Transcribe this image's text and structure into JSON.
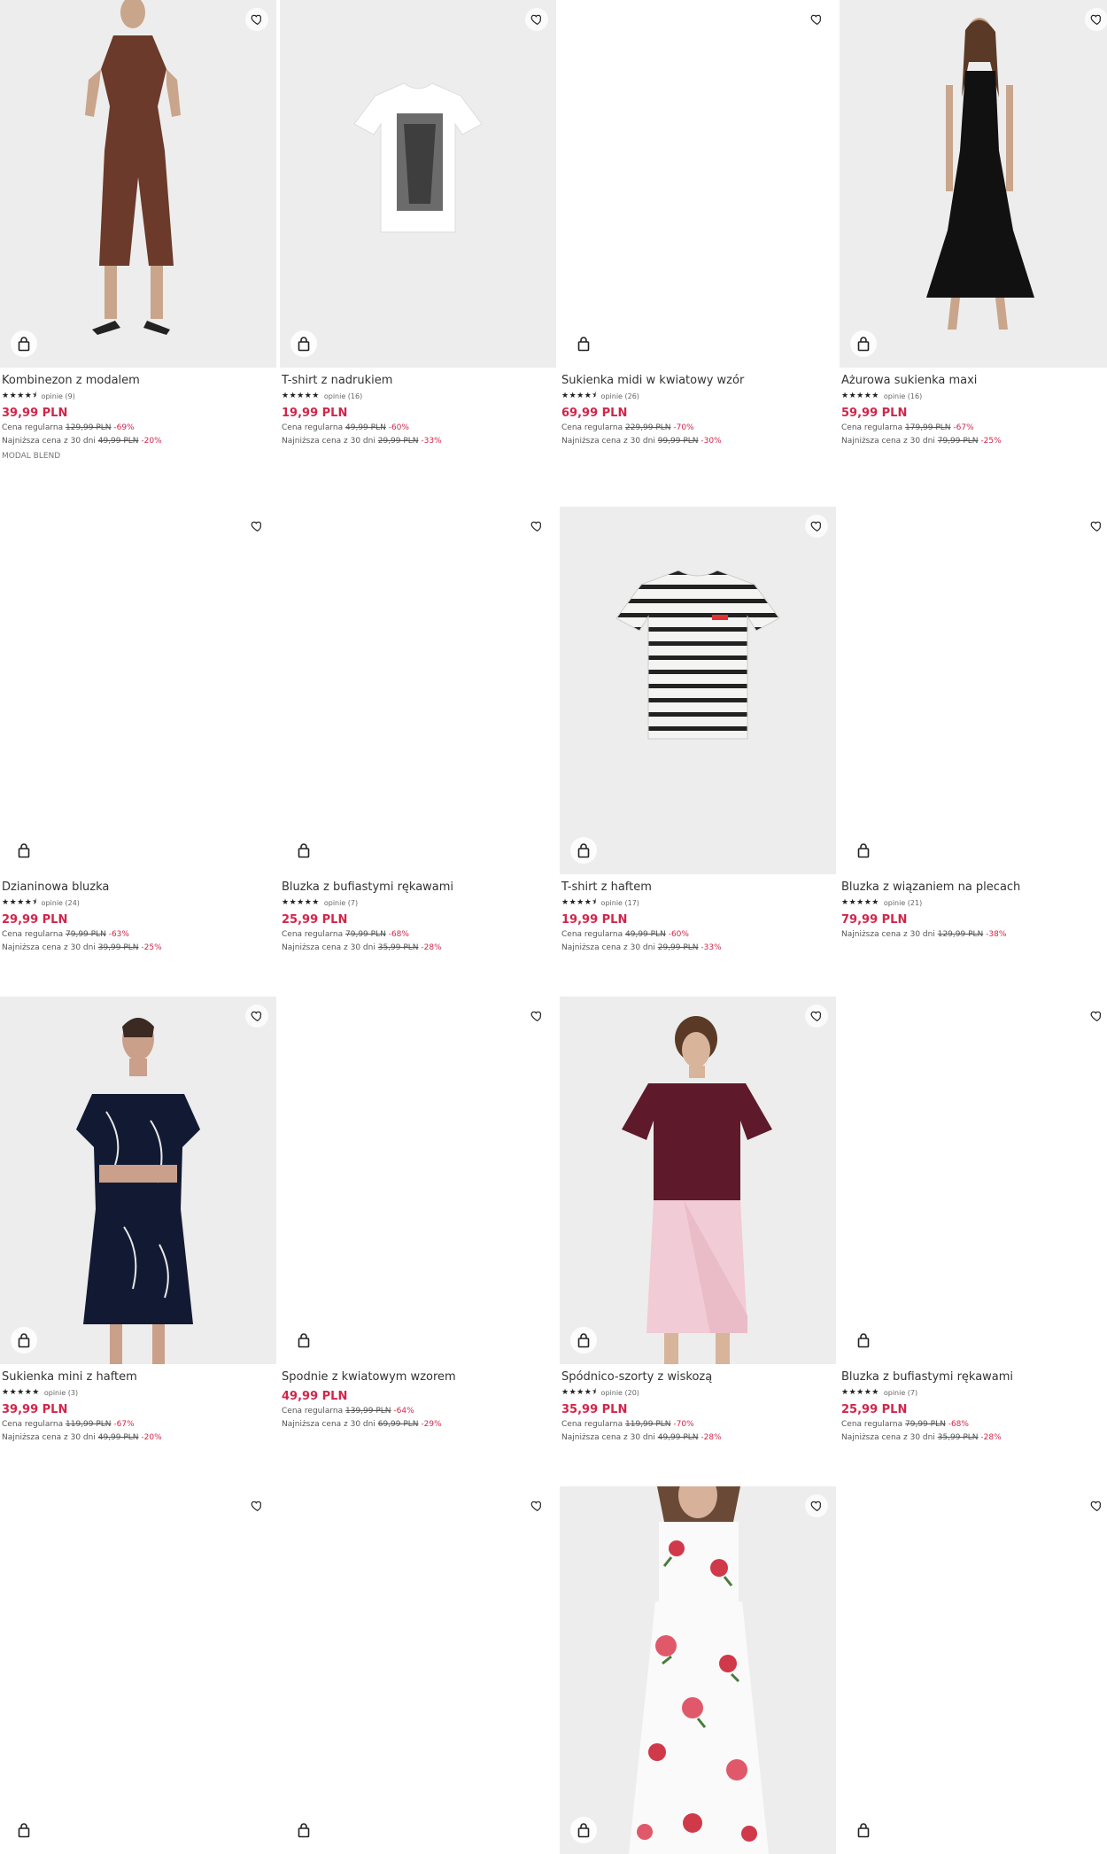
{
  "colors": {
    "price": "#d0264a",
    "photo_bg": "#ededed"
  },
  "icons": {
    "favorite": "heart-icon",
    "cart": "shopping-bag-icon"
  },
  "products": [
    {
      "name": "Kombinezon z modalem",
      "stars": "★★★★⯨",
      "reviews": "opinie (9)",
      "price": "39,99 PLN",
      "regular_label": "Cena regularna",
      "regular_price": "129,99 PLN",
      "regular_discount": "-69%",
      "lowest_label": "Najniższa cena z 30 dni",
      "lowest_price": "49,99 PLN",
      "lowest_discount": "-20%",
      "tag": "MODAL BLEND",
      "image": "jumpsuit"
    },
    {
      "name": "T-shirt z nadrukiem",
      "stars": "★★★★★",
      "reviews": "opinie (16)",
      "price": "19,99 PLN",
      "regular_label": "Cena regularna",
      "regular_price": "49,99 PLN",
      "regular_discount": "-60%",
      "lowest_label": "Najniższa cena z 30 dni",
      "lowest_price": "29,99 PLN",
      "lowest_discount": "-33%",
      "tag": "",
      "image": "tshirt-print"
    },
    {
      "name": "Sukienka midi w kwiatowy wzór",
      "stars": "★★★★⯨",
      "reviews": "opinie (26)",
      "price": "69,99 PLN",
      "regular_label": "Cena regularna",
      "regular_price": "229,99 PLN",
      "regular_discount": "-70%",
      "lowest_label": "Najniższa cena z 30 dni",
      "lowest_price": "99,99 PLN",
      "lowest_discount": "-30%",
      "tag": "",
      "image": ""
    },
    {
      "name": "Ażurowa sukienka maxi",
      "stars": "★★★★★",
      "reviews": "opinie (16)",
      "price": "59,99 PLN",
      "regular_label": "Cena regularna",
      "regular_price": "179,99 PLN",
      "regular_discount": "-67%",
      "lowest_label": "Najniższa cena z 30 dni",
      "lowest_price": "79,99 PLN",
      "lowest_discount": "-25%",
      "tag": "",
      "image": "black-dress"
    },
    {
      "name": "Dzianinowa bluzka",
      "stars": "★★★★⯨",
      "reviews": "opinie (24)",
      "price": "29,99 PLN",
      "regular_label": "Cena regularna",
      "regular_price": "79,99 PLN",
      "regular_discount": "-63%",
      "lowest_label": "Najniższa cena z 30 dni",
      "lowest_price": "39,99 PLN",
      "lowest_discount": "-25%",
      "tag": "",
      "image": ""
    },
    {
      "name": "Bluzka z bufiastymi rękawami",
      "stars": "★★★★★",
      "reviews": "opinie (7)",
      "price": "25,99 PLN",
      "regular_label": "Cena regularna",
      "regular_price": "79,99 PLN",
      "regular_discount": "-68%",
      "lowest_label": "Najniższa cena z 30 dni",
      "lowest_price": "35,99 PLN",
      "lowest_discount": "-28%",
      "tag": "",
      "image": ""
    },
    {
      "name": "T-shirt z haftem",
      "stars": "★★★★⯨",
      "reviews": "opinie (17)",
      "price": "19,99 PLN",
      "regular_label": "Cena regularna",
      "regular_price": "49,99 PLN",
      "regular_discount": "-60%",
      "lowest_label": "Najniższa cena z 30 dni",
      "lowest_price": "29,99 PLN",
      "lowest_discount": "-33%",
      "tag": "",
      "image": "striped-tshirt"
    },
    {
      "name": "Bluzka z wiązaniem na plecach",
      "stars": "★★★★★",
      "reviews": "opinie (21)",
      "price": "79,99 PLN",
      "regular_label": "Najniższa cena z 30 dni",
      "regular_price": "129,99 PLN",
      "regular_discount": "-38%",
      "lowest_label": "",
      "lowest_price": "",
      "lowest_discount": "",
      "tag": "",
      "image": ""
    },
    {
      "name": "Sukienka mini z haftem",
      "stars": "★★★★★",
      "reviews": "opinie (3)",
      "price": "39,99 PLN",
      "regular_label": "Cena regularna",
      "regular_price": "119,99 PLN",
      "regular_discount": "-67%",
      "lowest_label": "Najniższa cena z 30 dni",
      "lowest_price": "49,99 PLN",
      "lowest_discount": "-20%",
      "tag": "",
      "image": "navy-dress"
    },
    {
      "name": "Spodnie z kwiatowym wzorem",
      "stars": "",
      "reviews": "",
      "price": "49,99 PLN",
      "regular_label": "Cena regularna",
      "regular_price": "139,99 PLN",
      "regular_discount": "-64%",
      "lowest_label": "Najniższa cena z 30 dni",
      "lowest_price": "69,99 PLN",
      "lowest_discount": "-29%",
      "tag": "",
      "image": ""
    },
    {
      "name": "Spódnico-szorty z wiskozą",
      "stars": "★★★★⯨",
      "reviews": "opinie (20)",
      "price": "35,99 PLN",
      "regular_label": "Cena regularna",
      "regular_price": "119,99 PLN",
      "regular_discount": "-70%",
      "lowest_label": "Najniższa cena z 30 dni",
      "lowest_price": "49,99 PLN",
      "lowest_discount": "-28%",
      "tag": "",
      "image": "skort"
    },
    {
      "name": "Bluzka z bufiastymi rękawami",
      "stars": "★★★★★",
      "reviews": "opinie (7)",
      "price": "25,99 PLN",
      "regular_label": "Cena regularna",
      "regular_price": "79,99 PLN",
      "regular_discount": "-68%",
      "lowest_label": "Najniższa cena z 30 dni",
      "lowest_price": "35,99 PLN",
      "lowest_discount": "-28%",
      "tag": "",
      "image": ""
    },
    {
      "name": "",
      "stars": "",
      "reviews": "",
      "price": "",
      "regular_label": "",
      "regular_price": "",
      "regular_discount": "",
      "lowest_label": "",
      "lowest_price": "",
      "lowest_discount": "",
      "tag": "",
      "image": ""
    },
    {
      "name": "",
      "stars": "",
      "reviews": "",
      "price": "",
      "regular_label": "",
      "regular_price": "",
      "regular_discount": "",
      "lowest_label": "",
      "lowest_price": "",
      "lowest_discount": "",
      "tag": "",
      "image": ""
    },
    {
      "name": "",
      "stars": "",
      "reviews": "",
      "price": "",
      "regular_label": "",
      "regular_price": "",
      "regular_discount": "",
      "lowest_label": "",
      "lowest_price": "",
      "lowest_discount": "",
      "tag": "",
      "image": "floral-dress"
    },
    {
      "name": "",
      "stars": "",
      "reviews": "",
      "price": "",
      "regular_label": "",
      "regular_price": "",
      "regular_discount": "",
      "lowest_label": "",
      "lowest_price": "",
      "lowest_discount": "",
      "tag": "",
      "image": ""
    }
  ]
}
